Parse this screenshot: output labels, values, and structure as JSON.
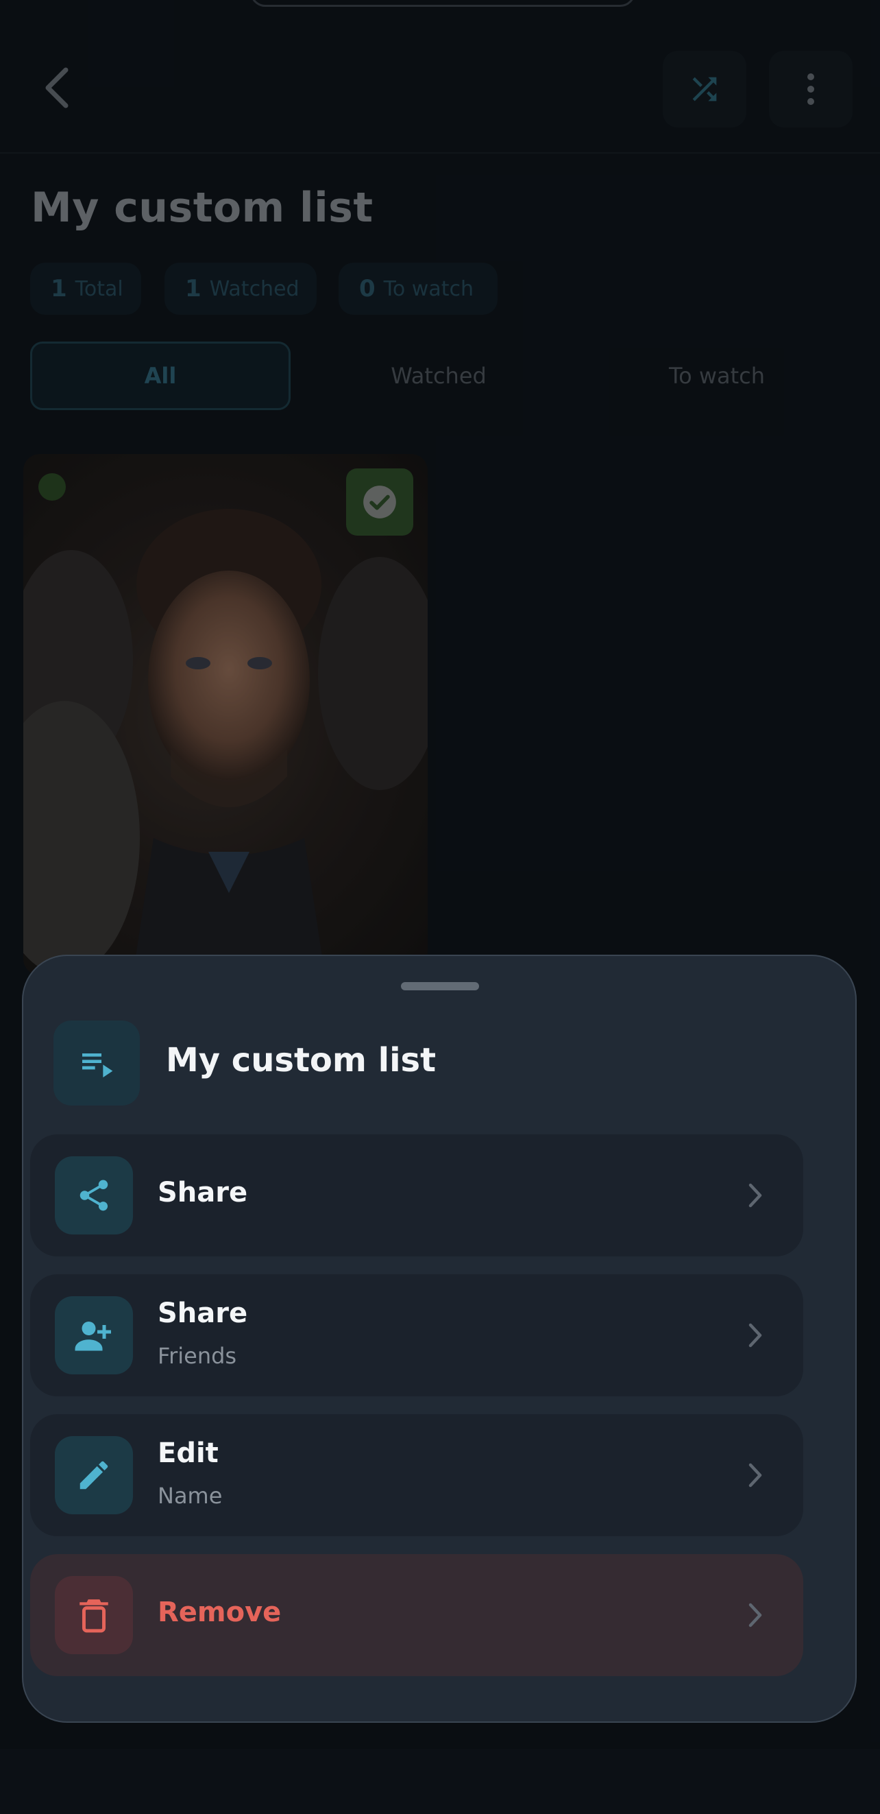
{
  "header": {
    "back_icon": "chevron-left-icon",
    "shuffle_icon": "shuffle-icon",
    "more_icon": "more-vertical-icon"
  },
  "page": {
    "title": "My custom list"
  },
  "stats": [
    {
      "count": "1",
      "label": "Total"
    },
    {
      "count": "1",
      "label": "Watched"
    },
    {
      "count": "0",
      "label": "To watch"
    }
  ],
  "filter_tabs": [
    {
      "label": "All",
      "selected": true
    },
    {
      "label": "Watched",
      "selected": false
    },
    {
      "label": "To watch",
      "selected": false
    }
  ],
  "items": [
    {
      "watched": true,
      "status_color": "#2c4b22"
    }
  ],
  "sheet": {
    "title": "My custom list",
    "header_icon": "playlist-play-icon",
    "options": [
      {
        "label": "Share",
        "sublabel": "",
        "icon": "share-icon"
      },
      {
        "label": "Share",
        "sublabel": "Friends",
        "icon": "person-add-icon"
      },
      {
        "label": "Edit",
        "sublabel": "Name",
        "icon": "pencil-icon"
      },
      {
        "label": "Remove",
        "sublabel": "",
        "icon": "trash-icon",
        "destructive": true
      }
    ]
  },
  "colors": {
    "background": "#0d1116",
    "sheet": "#212a35",
    "accent": "#4fb3cf",
    "danger": "#e5645a",
    "watched": "#2f4f27"
  }
}
